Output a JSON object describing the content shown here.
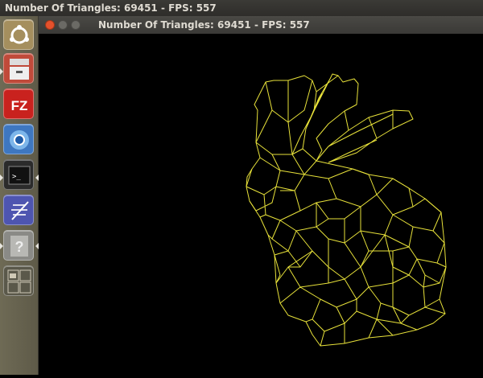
{
  "topbar": {
    "title": "Number Of Triangles: 69451 - FPS: 557"
  },
  "window": {
    "title": "Number Of Triangles: 69451 - FPS: 557"
  },
  "launcher": {
    "items": [
      {
        "name": "ubuntu-dash",
        "icon": "ubuntu-logo-icon"
      },
      {
        "name": "files",
        "icon": "file-cabinet-icon"
      },
      {
        "name": "filezilla",
        "icon": "filezilla-icon",
        "label": "FZ"
      },
      {
        "name": "chromium",
        "icon": "chromium-icon"
      },
      {
        "name": "terminal",
        "icon": "terminal-icon",
        "label": ">_"
      },
      {
        "name": "text-editor",
        "icon": "text-editor-icon"
      },
      {
        "name": "unknown-app",
        "icon": "question-mark-icon",
        "label": "?"
      },
      {
        "name": "workspace-switcher",
        "icon": "workspace-switcher-icon"
      }
    ]
  },
  "colors": {
    "wireframe": "#e8e23a",
    "background": "#000000",
    "close": "#e4512c"
  }
}
